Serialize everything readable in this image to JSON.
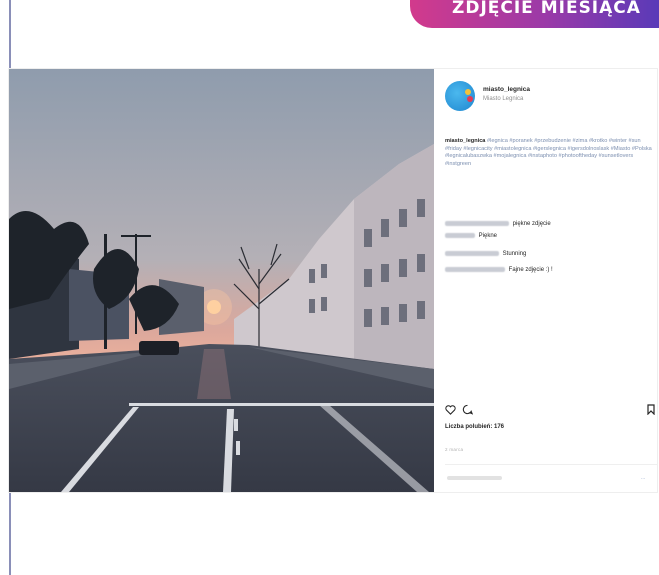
{
  "banner": {
    "label": "ZDJĘCIE MIESIĄCA"
  },
  "post": {
    "username": "miasto_legnica",
    "location": "Miasto Legnica",
    "caption_user": "miasto_legnica",
    "caption_tags": "#legnica #poranek #przebudzenie #zima #krotko #winter #sun #friday #legnicacity #miastolegnica #igerslegnica #igersdolnoslask #Miasto #Polska #legnicalubaszwka #mojalegnica #instaphoto #photooftheday #sunsetlovers #instgreen",
    "comments": [
      {
        "text": "piękne zdjęcie"
      },
      {
        "text": "Piękne"
      },
      {
        "text": "Stunning"
      },
      {
        "text": "Fajne zdjęcie :) !"
      }
    ],
    "likes": "Liczba polubień: 176",
    "date": "2 marca",
    "post_button": "..."
  },
  "icons": {
    "like": "heart-icon",
    "comment": "comment-bubble-icon",
    "save": "bookmark-icon"
  },
  "colors": {
    "banner_start": "#d23a8c",
    "banner_end": "#5a3ab8",
    "avatar": "#2a96dc",
    "hashtag": "#7c8fb0",
    "sky_top": "#9aa6b4",
    "sky_horizon": "#e8a89a"
  }
}
